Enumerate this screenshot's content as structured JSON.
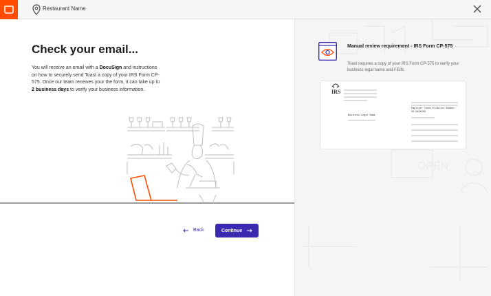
{
  "header": {
    "restaurant_name": "Restaurant Name"
  },
  "main": {
    "title": "Check your email...",
    "body": {
      "p1": "You will receive an email with a ",
      "docusign": "DocuSign",
      "p2": " and instructions on how to securely send Toast a copy of your IRS Form CP-575. Once our team receives your the form, it can take up to ",
      "days": "2 business days",
      "p3": " to verify your business information."
    },
    "back_label": "Back",
    "continue_label": "Continue"
  },
  "side": {
    "title": "Manual review requirement - IRS Form CP-575",
    "description": "Toast requires a copy of your IRS Form CP-575 to verify your business legal name and FEIN.",
    "doc": {
      "irs_label": "IRS",
      "business_legal_name": "Business Legal Name",
      "ein_label": "Employer Identification Number:",
      "ein_value": "XX-XXXXXXX"
    },
    "open_sign": "OPEN"
  },
  "colors": {
    "brand_orange": "#ff4c00",
    "primary_purple": "#3a2ab0"
  }
}
